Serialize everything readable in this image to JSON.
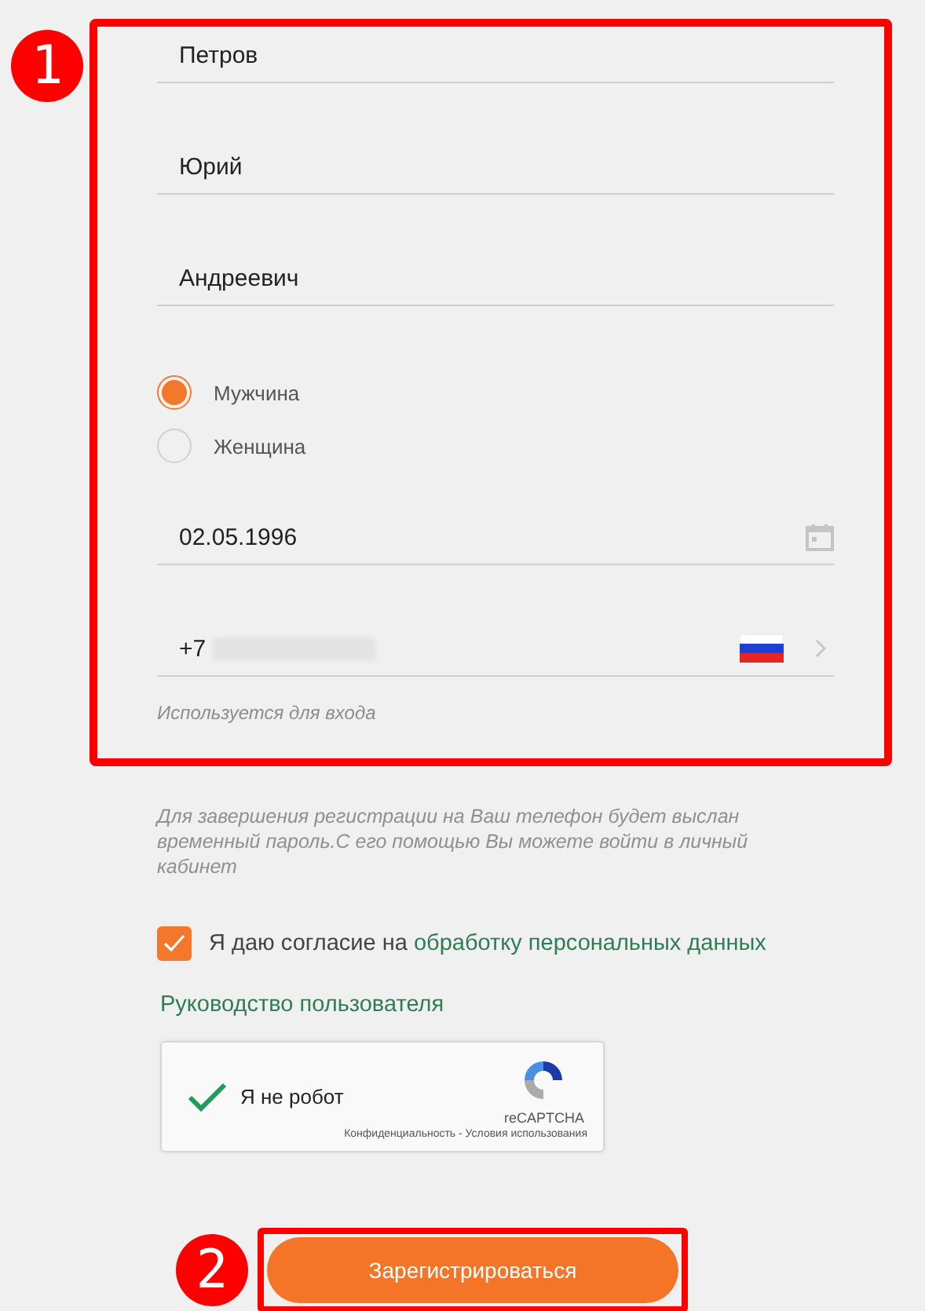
{
  "form_callout": "1",
  "name_fields": [
    {
      "value": "Петров"
    },
    {
      "value": "Юрий"
    },
    {
      "value": "Андреевич"
    }
  ],
  "gender": [
    {
      "label": "Мужчина",
      "selected": true
    },
    {
      "label": "Женщина",
      "selected": false
    }
  ],
  "birth_date": {
    "value": "02.05.1996"
  },
  "phone": {
    "prefix": "+7",
    "hint": "Используется для входа"
  },
  "note": "Для завершения регистрации на Ваш телефон будет выслан временный пароль.С его помощью Вы можете войти в личный кабинет",
  "consent": {
    "checked": true,
    "text": "Я даю согласие на ",
    "link": "обработку персональных данных"
  },
  "guide_link": "Руководство пользователя",
  "captcha": {
    "checked": true,
    "label": "Я не робот",
    "brand": "reCAPTCHA",
    "footer": "Конфиденциальность - Условия использования"
  },
  "submit": {
    "label": "Зарегистрироваться",
    "callout": "2"
  }
}
